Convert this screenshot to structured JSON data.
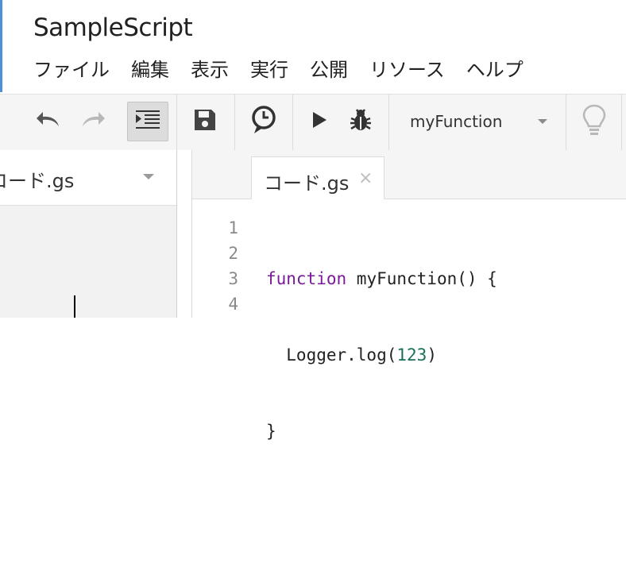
{
  "app": {
    "title": "SampleScript"
  },
  "menu": [
    "ファイル",
    "編集",
    "表示",
    "実行",
    "公開",
    "リソース",
    "ヘルプ"
  ],
  "toolbar": {
    "function_selected": "myFunction",
    "icons": [
      "undo-icon",
      "redo-icon",
      "indent-icon",
      "save-icon",
      "clock-icon",
      "play-icon",
      "bug-icon",
      "lightbulb-icon"
    ]
  },
  "files": {
    "current": "コード.gs"
  },
  "editor": {
    "tab": {
      "label": "コード.gs",
      "close": "×"
    },
    "line_numbers": [
      "1",
      "2",
      "3",
      "4"
    ],
    "code": {
      "line1": {
        "keyword": "function",
        "rest": " myFunction() {"
      },
      "line2": {
        "prefix": "  Logger.log(",
        "number": "123",
        "suffix": ")"
      },
      "line3": {
        "text": "}"
      },
      "line4": {
        "text": ""
      }
    }
  },
  "colors": {
    "accent": "#4a90d9",
    "keyword": "#7a1b99",
    "number": "#1b6f5a"
  }
}
